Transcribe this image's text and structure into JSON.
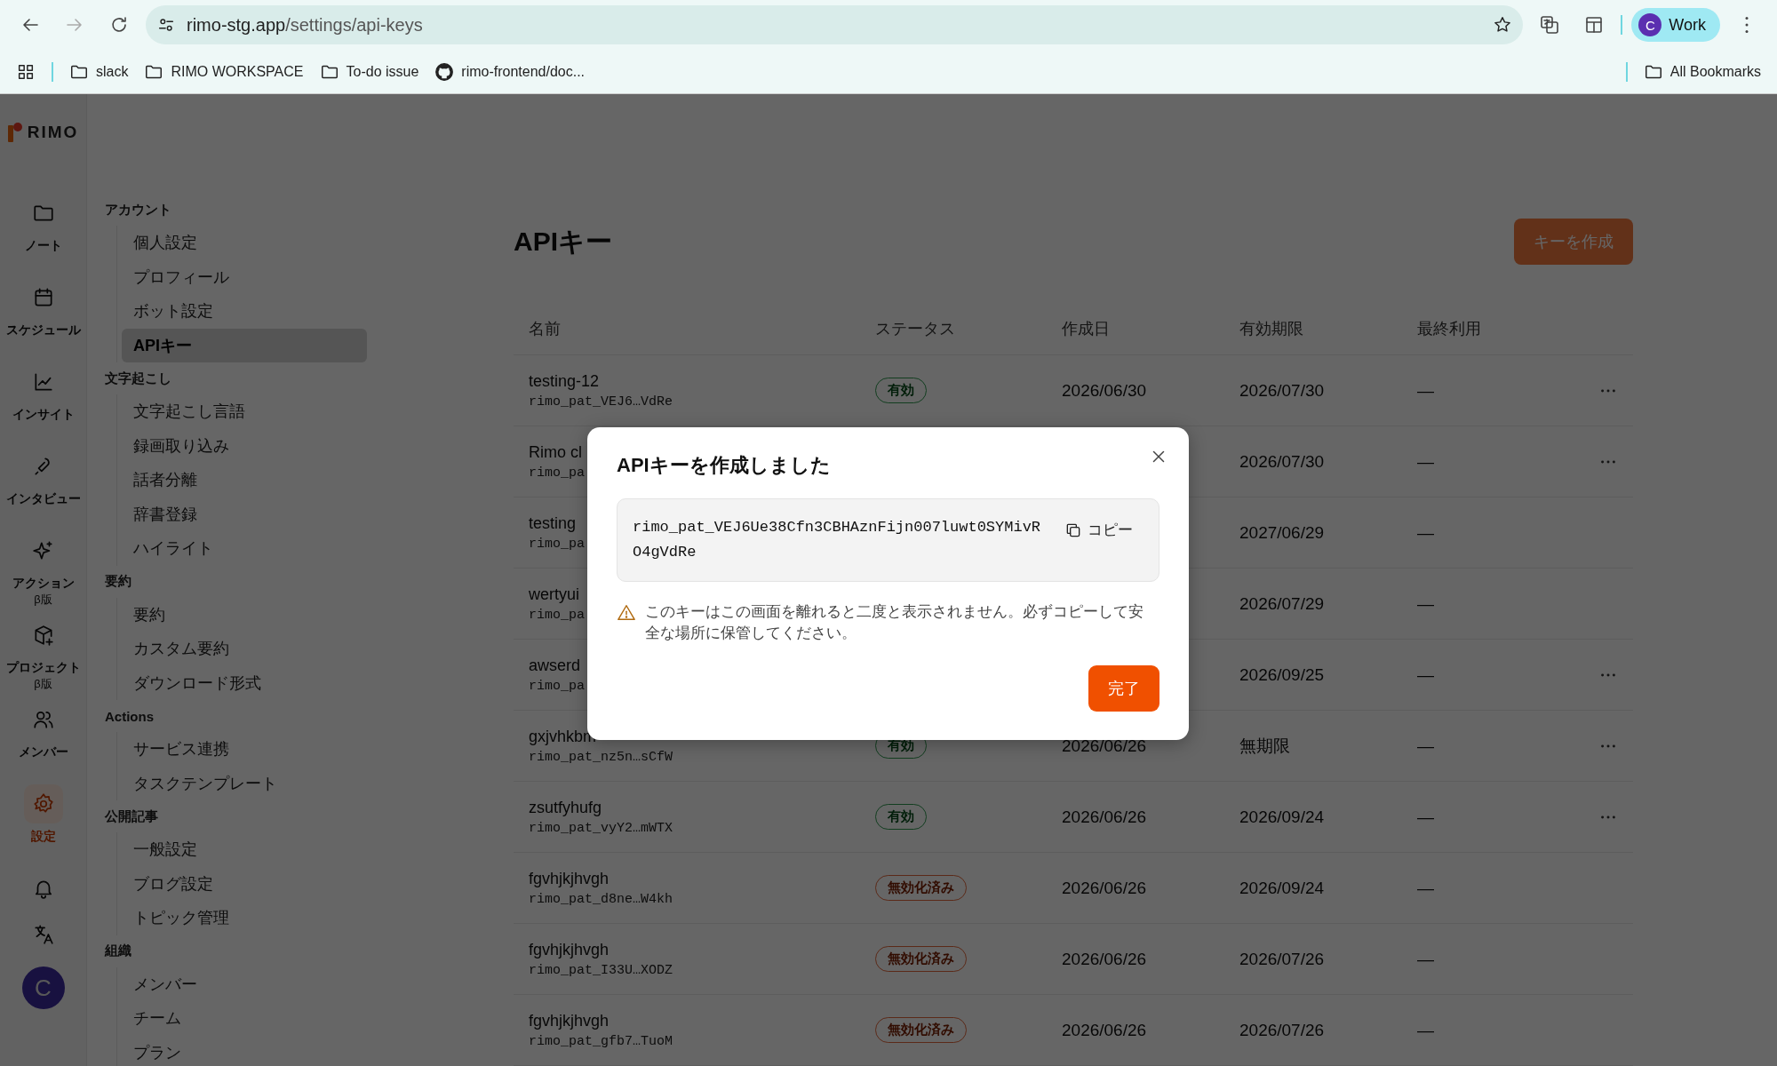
{
  "browser": {
    "url_host": "rimo-stg.app",
    "url_path": "/settings/api-keys",
    "profile": {
      "initial": "C",
      "label": "Work"
    },
    "bookmarks": [
      {
        "kind": "folder",
        "label": "slack"
      },
      {
        "kind": "folder",
        "label": "RIMO WORKSPACE"
      },
      {
        "kind": "folder",
        "label": "To-do issue"
      },
      {
        "kind": "github",
        "label": "rimo-frontend/doc..."
      }
    ],
    "all_bookmarks": "All Bookmarks"
  },
  "logo": "RIMO",
  "rail": [
    {
      "kind": "note",
      "label": "ノート",
      "selected": false
    },
    {
      "kind": "schedule",
      "label": "スケジュール",
      "selected": false
    },
    {
      "kind": "insight",
      "label": "インサイト",
      "selected": false
    },
    {
      "kind": "interview",
      "label": "インタビュー",
      "selected": false
    },
    {
      "kind": "action",
      "label": "アクション",
      "sublabel": "β版",
      "selected": false
    },
    {
      "kind": "project",
      "label": "プロジェクト",
      "sublabel": "β版",
      "selected": false
    },
    {
      "kind": "member",
      "label": "メンバー",
      "selected": false
    },
    {
      "kind": "settings",
      "label": "設定",
      "selected": true
    },
    {
      "kind": "bell",
      "selected": false
    },
    {
      "kind": "language",
      "selected": false
    }
  ],
  "avatar": "C",
  "settings_nav": [
    {
      "title": "アカウント",
      "items": [
        {
          "label": "個人設定",
          "selected": false
        },
        {
          "label": "プロフィール",
          "selected": false
        },
        {
          "label": "ボット設定",
          "selected": false
        },
        {
          "label": "APIキー",
          "selected": true
        }
      ]
    },
    {
      "title": "文字起こし",
      "items": [
        {
          "label": "文字起こし言語",
          "selected": false
        },
        {
          "label": "録画取り込み",
          "selected": false
        },
        {
          "label": "話者分離",
          "selected": false
        },
        {
          "label": "辞書登録",
          "selected": false
        },
        {
          "label": "ハイライト",
          "selected": false
        }
      ]
    },
    {
      "title": "要約",
      "items": [
        {
          "label": "要約",
          "selected": false
        },
        {
          "label": "カスタム要約",
          "selected": false
        },
        {
          "label": "ダウンロード形式",
          "selected": false
        }
      ]
    },
    {
      "title": "Actions",
      "items": [
        {
          "label": "サービス連携",
          "selected": false
        },
        {
          "label": "タスクテンプレート",
          "selected": false
        }
      ]
    },
    {
      "title": "公開記事",
      "items": [
        {
          "label": "一般設定",
          "selected": false
        },
        {
          "label": "ブログ設定",
          "selected": false
        },
        {
          "label": "トピック管理",
          "selected": false
        }
      ]
    },
    {
      "title": "組織",
      "items": [
        {
          "label": "メンバー",
          "selected": false
        },
        {
          "label": "チーム",
          "selected": false
        },
        {
          "label": "プラン",
          "selected": false
        }
      ]
    }
  ],
  "page_title": "APIキー",
  "create_button": "キーを作成",
  "table": {
    "columns": [
      "名前",
      "ステータス",
      "作成日",
      "有効期限",
      "最終利用"
    ],
    "rows": [
      {
        "name": "testing-12",
        "key": "rimo_pat_VEJ6…VdRe",
        "status": {
          "kind": "active",
          "label": "有効"
        },
        "created": "2026/06/30",
        "expires": "2026/07/30",
        "last_used": "—",
        "menu": true
      },
      {
        "name": "Rimo cl",
        "key": "rimo_pa",
        "expires": "2026/07/30",
        "last_used": "—",
        "menu": true
      },
      {
        "name": "testing",
        "key": "rimo_pa",
        "expires": "2027/06/29",
        "last_used": "—",
        "menu": false
      },
      {
        "name": "wertyui",
        "key": "rimo_pa",
        "expires": "2026/07/29",
        "last_used": "—",
        "menu": false
      },
      {
        "name": "awserd",
        "key": "rimo_pa",
        "expires": "2026/09/25",
        "last_used": "—",
        "menu": true
      },
      {
        "name": "gxjvhkbm",
        "key": "rimo_pat_nz5n…sCfW",
        "status": {
          "kind": "active",
          "label": "有効"
        },
        "created": "2026/06/26",
        "expires": "無期限",
        "last_used": "—",
        "menu": true
      },
      {
        "name": "zsutfyhufg",
        "key": "rimo_pat_vyY2…mWTX",
        "status": {
          "kind": "active",
          "label": "有効"
        },
        "created": "2026/06/26",
        "expires": "2026/09/24",
        "last_used": "—",
        "menu": true
      },
      {
        "name": "fgvhjkjhvgh",
        "key": "rimo_pat_d8ne…W4kh",
        "status": {
          "kind": "revoked",
          "label": "無効化済み"
        },
        "created": "2026/06/26",
        "expires": "2026/09/24",
        "last_used": "—",
        "menu": false
      },
      {
        "name": "fgvhjkjhvgh",
        "key": "rimo_pat_I33U…XODZ",
        "status": {
          "kind": "revoked",
          "label": "無効化済み"
        },
        "created": "2026/06/26",
        "expires": "2026/07/26",
        "last_used": "—",
        "menu": false
      },
      {
        "name": "fgvhjkjhvgh",
        "key": "rimo_pat_gfb7…TuoM",
        "status": {
          "kind": "revoked",
          "label": "無効化済み"
        },
        "created": "2026/06/26",
        "expires": "2026/07/26",
        "last_used": "—",
        "menu": false
      }
    ]
  },
  "dialog": {
    "title": "APIキーを作成しました",
    "key": "rimo_pat_VEJ6Ue38Cfn3CBHAznFijn007luwt0SYMivRO4gVdRe",
    "copy": "コピー",
    "warning": "このキーはこの画面を離れると二度と表示されません。必ずコピーして安全な場所に保管してください。",
    "done": "完了"
  }
}
